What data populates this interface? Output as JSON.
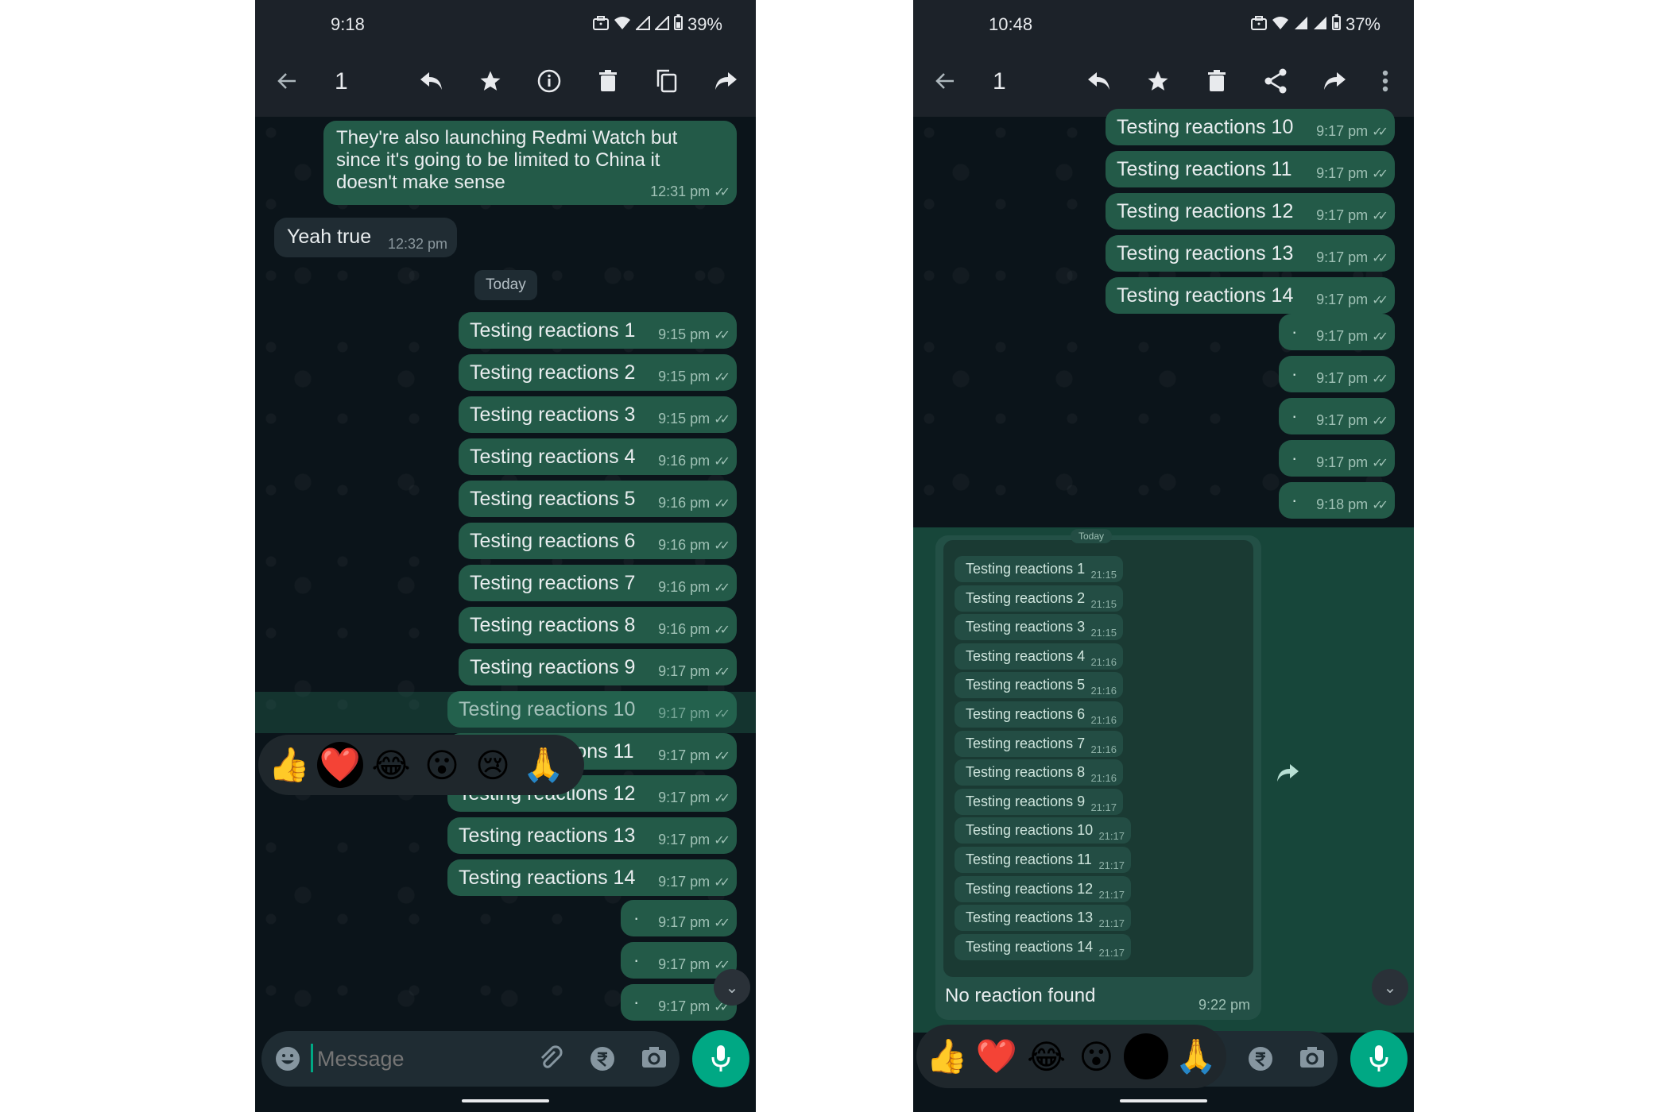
{
  "left": {
    "status": {
      "time": "9:18",
      "battery": "39%"
    },
    "toolbar": {
      "count": "1",
      "icons": [
        "back-arrow-icon",
        "reply-icon",
        "star-icon",
        "info-icon",
        "delete-icon",
        "copy-icon",
        "forward-icon"
      ]
    },
    "messages": [
      {
        "type": "out",
        "text_lines": [
          "They're also launching Redmi Watch but",
          "since it's going to be limited to China it",
          "doesn't make sense"
        ],
        "time": "12:31 pm"
      },
      {
        "type": "in",
        "text": "Yeah true",
        "time": "12:32 pm"
      }
    ],
    "date_chip": "Today",
    "tests": [
      {
        "text": "Testing reactions 1",
        "time": "9:15 pm"
      },
      {
        "text": "Testing reactions 2",
        "time": "9:15 pm"
      },
      {
        "text": "Testing reactions 3",
        "time": "9:15 pm"
      },
      {
        "text": "Testing reactions 4",
        "time": "9:16 pm"
      },
      {
        "text": "Testing reactions 5",
        "time": "9:16 pm"
      },
      {
        "text": "Testing reactions 6",
        "time": "9:16 pm"
      },
      {
        "text": "Testing reactions 7",
        "time": "9:16 pm"
      },
      {
        "text": "Testing reactions 8",
        "time": "9:16 pm"
      },
      {
        "text": "Testing reactions 9",
        "time": "9:17 pm"
      },
      {
        "text": "Testing reactions 10",
        "time": "9:17 pm"
      },
      {
        "text": "Testing reactions 11",
        "time": "9:17 pm"
      },
      {
        "text": "Testing reactions 12",
        "time": "9:17 pm"
      },
      {
        "text": "Testing reactions 13",
        "time": "9:17 pm"
      },
      {
        "text": "Testing reactions 14",
        "time": "9:17 pm"
      }
    ],
    "dot_messages": [
      {
        "text": "·",
        "time": "9:17 pm"
      },
      {
        "text": "·",
        "time": "9:17 pm"
      },
      {
        "text": "·",
        "time": "9:17 pm"
      }
    ],
    "reactions": [
      "👍",
      "❤️",
      "😂",
      "😮",
      "😢",
      "🙏"
    ],
    "selected_reaction": 1,
    "composer": {
      "placeholder": "Message"
    }
  },
  "right": {
    "status": {
      "time": "10:48",
      "battery": "37%"
    },
    "toolbar": {
      "count": "1",
      "icons": [
        "back-arrow-icon",
        "reply-icon",
        "star-icon",
        "delete-icon",
        "share-icon",
        "forward-icon",
        "more-vert-icon"
      ]
    },
    "tests": [
      {
        "text": "Testing reactions 10",
        "time": "9:17 pm"
      },
      {
        "text": "Testing reactions 11",
        "time": "9:17 pm"
      },
      {
        "text": "Testing reactions 12",
        "time": "9:17 pm"
      },
      {
        "text": "Testing reactions 13",
        "time": "9:17 pm"
      },
      {
        "text": "Testing reactions 14",
        "time": "9:17 pm"
      }
    ],
    "dot_messages": [
      {
        "text": "·",
        "time": "9:17 pm"
      },
      {
        "text": "·",
        "time": "9:17 pm"
      },
      {
        "text": "·",
        "time": "9:17 pm"
      },
      {
        "text": "·",
        "time": "9:17 pm"
      },
      {
        "text": "·",
        "time": "9:18 pm"
      }
    ],
    "screenshot_msg": {
      "date_chip": "Today",
      "items": [
        {
          "text": "Testing reactions 1",
          "time": "21:15"
        },
        {
          "text": "Testing reactions 2",
          "time": "21:15"
        },
        {
          "text": "Testing reactions 3",
          "time": "21:15"
        },
        {
          "text": "Testing reactions 4",
          "time": "21:16"
        },
        {
          "text": "Testing reactions 5",
          "time": "21:16"
        },
        {
          "text": "Testing reactions 6",
          "time": "21:16"
        },
        {
          "text": "Testing reactions 7",
          "time": "21:16"
        },
        {
          "text": "Testing reactions 8",
          "time": "21:16"
        },
        {
          "text": "Testing reactions 9",
          "time": "21:17"
        },
        {
          "text": "Testing reactions 10",
          "time": "21:17"
        },
        {
          "text": "Testing reactions 11",
          "time": "21:17"
        },
        {
          "text": "Testing reactions 12",
          "time": "21:17"
        },
        {
          "text": "Testing reactions 13",
          "time": "21:17"
        },
        {
          "text": "Testing reactions 14",
          "time": "21:17"
        }
      ],
      "caption": "No reaction found",
      "time": "9:22 pm"
    },
    "reactions": [
      "👍",
      "❤️",
      "😂",
      "😮",
      "😢",
      "🙏"
    ],
    "selected_reaction": 4
  },
  "colors": {
    "accent": "#00a884",
    "bubble_out": "#235a48",
    "bubble_in": "#202c33",
    "bar": "#1c2229"
  }
}
